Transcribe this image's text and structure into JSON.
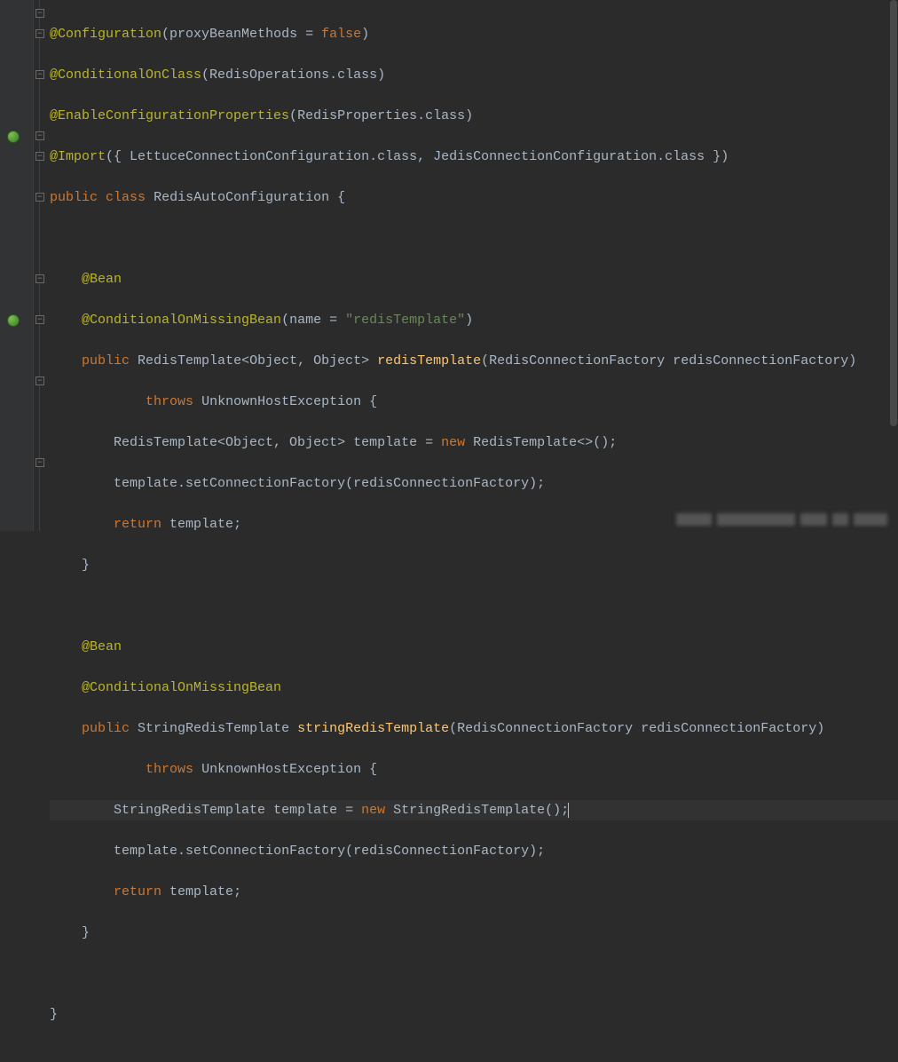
{
  "colors": {
    "bg": "#2b2b2b",
    "annot": "#bbb529",
    "keyword": "#cc7832",
    "string": "#6a8759",
    "method": "#ffc66d",
    "text": "#a9b7c6"
  },
  "annot": {
    "configuration": "@Configuration",
    "conditionalOnClass": "@ConditionalOnClass",
    "enableConfigProps": "@EnableConfigurationProperties",
    "import": "@Import",
    "bean": "@Bean",
    "conditionalOnMissingBean": "@ConditionalOnMissingBean"
  },
  "tokens": {
    "proxyBeanMethods": "proxyBeanMethods = ",
    "false": "false",
    "redisOperations": "RedisOperations",
    "dotClass": ".class",
    "redisProperties": "RedisProperties",
    "lettuceCfg": "LettuceConnectionConfiguration",
    "jedisCfg": "JedisConnectionConfiguration",
    "public": "public",
    "class": "class",
    "className": "RedisAutoConfiguration",
    "nameAttr": "name = ",
    "redisTemplateStr": "\"redisTemplate\"",
    "redisTemplate": "RedisTemplate",
    "genericOO": "<Object, Object>",
    "redisTemplateMethod": "redisTemplate",
    "redisConnFactory": "RedisConnectionFactory",
    "redisConnFactoryParam": "redisConnectionFactory",
    "throws": "throws",
    "unknownHostEx": "UnknownHostException",
    "templateVar": "template",
    "eq": " = ",
    "new": "new",
    "diamond": "<>",
    "setConnFactory": "setConnectionFactory",
    "return": "return",
    "stringRedisTemplate": "StringRedisTemplate",
    "stringRedisTemplateMethod": "stringRedisTemplate"
  },
  "punc": {
    "openParen": "(",
    "closeParen": ")",
    "openBrace": "{",
    "closeBrace": "}",
    "openBraceSp": "{ ",
    "closeBraceSp": " }",
    "comma": ", ",
    "semi": ";",
    "dot": "."
  },
  "indent": {
    "i0": "",
    "i1": "    ",
    "i2": "        ",
    "i3": "            "
  },
  "gutterIcons": [
    {
      "line": 6,
      "name": "spring-bean-icon"
    },
    {
      "line": 15,
      "name": "spring-bean-icon"
    }
  ],
  "foldMarkers": [
    {
      "line": 0,
      "glyph": "−"
    },
    {
      "line": 1,
      "glyph": "−"
    },
    {
      "line": 3,
      "glyph": "−"
    },
    {
      "line": 6,
      "glyph": "−"
    },
    {
      "line": 7,
      "glyph": "−"
    },
    {
      "line": 9,
      "glyph": "−"
    },
    {
      "line": 13,
      "glyph": "−"
    },
    {
      "line": 15,
      "glyph": "−"
    },
    {
      "line": 18,
      "glyph": "−"
    },
    {
      "line": 22,
      "glyph": "−"
    }
  ]
}
